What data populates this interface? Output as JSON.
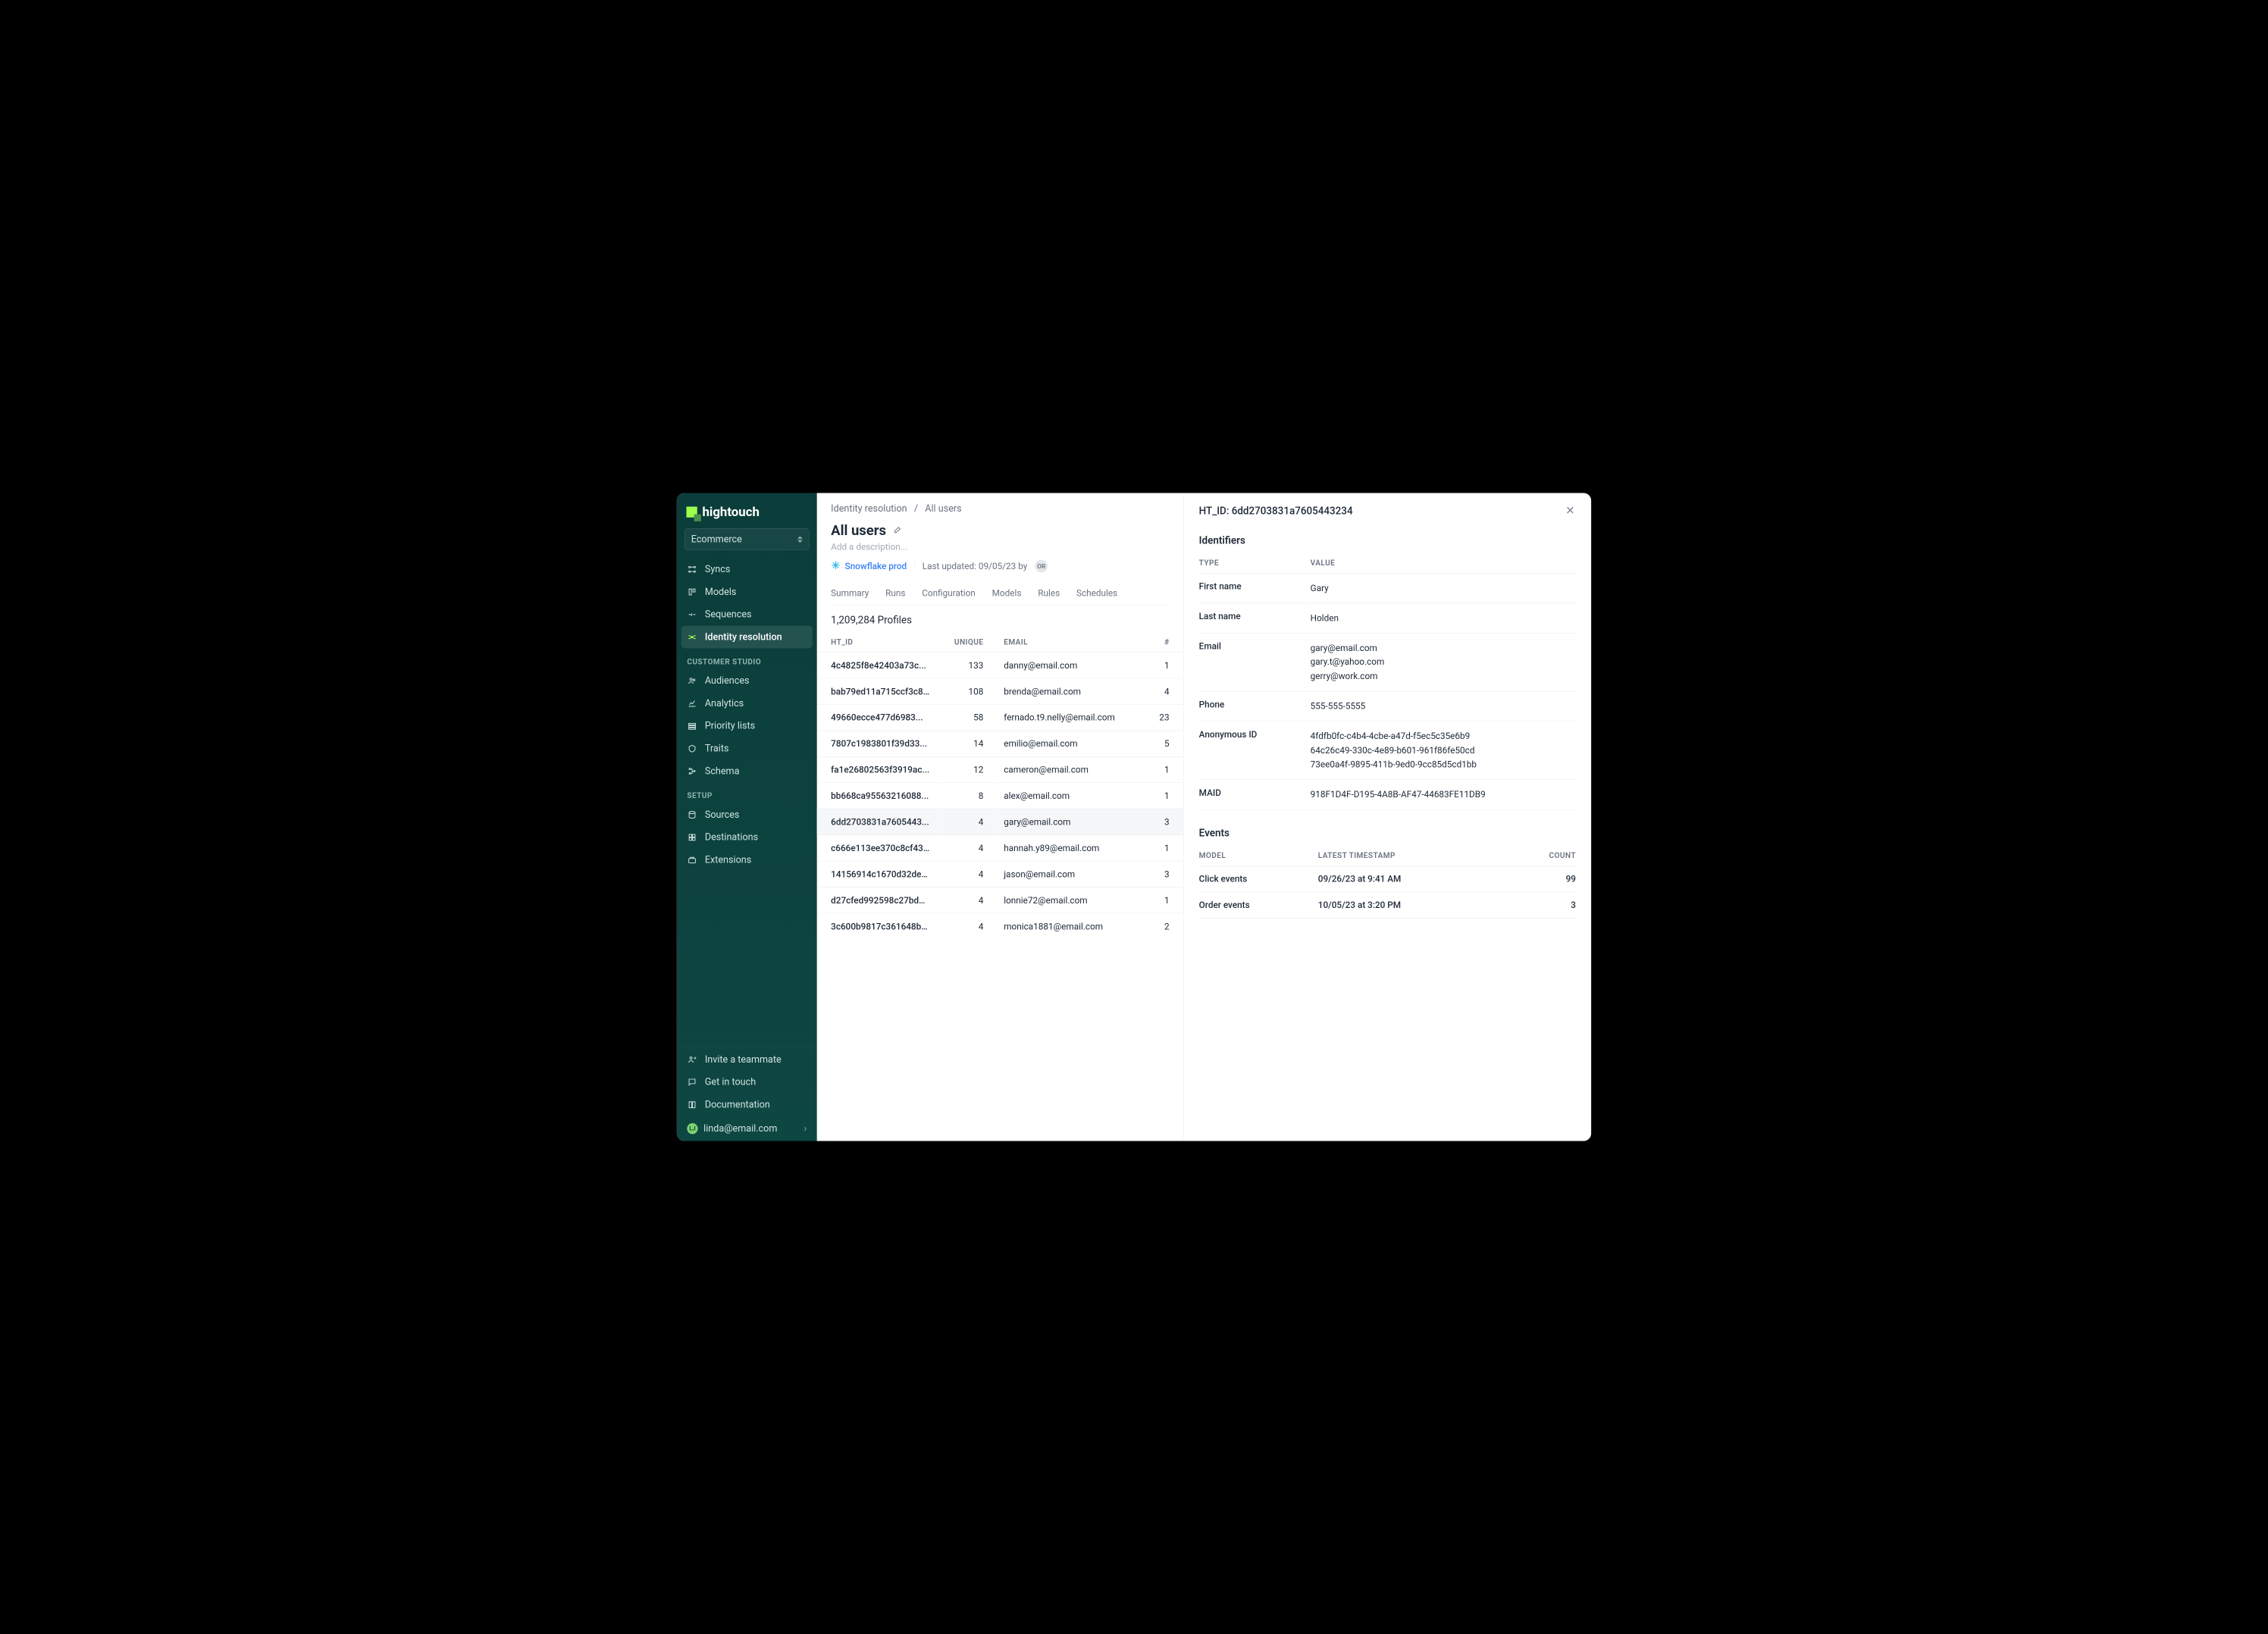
{
  "brand": "hightouch",
  "workspace": {
    "current": "Ecommerce"
  },
  "sidebar": {
    "items": [
      {
        "label": "Syncs"
      },
      {
        "label": "Models"
      },
      {
        "label": "Sequences"
      },
      {
        "label": "Identity resolution",
        "active": true
      }
    ],
    "studio_heading": "CUSTOMER STUDIO",
    "studio": [
      {
        "label": "Audiences"
      },
      {
        "label": "Analytics"
      },
      {
        "label": "Priority lists"
      },
      {
        "label": "Traits"
      },
      {
        "label": "Schema"
      }
    ],
    "setup_heading": "SETUP",
    "setup": [
      {
        "label": "Sources"
      },
      {
        "label": "Destinations"
      },
      {
        "label": "Extensions"
      }
    ],
    "footer": [
      {
        "label": "Invite a teammate"
      },
      {
        "label": "Get in touch"
      },
      {
        "label": "Documentation"
      }
    ],
    "user": {
      "initials": "LJ",
      "email": "linda@email.com"
    }
  },
  "crumbs": {
    "root": "Identity resolution",
    "sep": "/",
    "leaf": "All users"
  },
  "page": {
    "title": "All users",
    "desc": "Add a description...",
    "source": "Snowflake prod",
    "updated": "Last updated: 09/05/23 by",
    "updated_by": "OR"
  },
  "tabs": [
    "Summary",
    "Runs",
    "Configuration",
    "Models",
    "Rules",
    "Schedules"
  ],
  "profiles_count": "1,209,284 Profiles",
  "table": {
    "cols": [
      "HT_ID",
      "UNIQUE",
      "EMAIL",
      "#"
    ],
    "rows": [
      {
        "id": "4c4825f8e42403a73c...",
        "unique": "133",
        "email": "danny@email.com",
        "n": "1"
      },
      {
        "id": "bab79ed11a715ccf3c8...",
        "unique": "108",
        "email": "brenda@email.com",
        "n": "4"
      },
      {
        "id": "49660ecce477d6983...",
        "unique": "58",
        "email": "fernado.t9.nelly@email.com",
        "n": "23"
      },
      {
        "id": "7807c1983801f39d33...",
        "unique": "14",
        "email": "emilio@email.com",
        "n": "5"
      },
      {
        "id": "fa1e26802563f3919ac...",
        "unique": "12",
        "email": "cameron@email.com",
        "n": "1"
      },
      {
        "id": "bb668ca95563216088...",
        "unique": "8",
        "email": "alex@email.com",
        "n": "1"
      },
      {
        "id": "6dd2703831a7605443...",
        "unique": "4",
        "email": "gary@email.com",
        "n": "3",
        "sel": true
      },
      {
        "id": "c666e113ee370c8cf43...",
        "unique": "4",
        "email": "hannah.y89@email.com",
        "n": "1"
      },
      {
        "id": "14156914c1670d32dea...",
        "unique": "4",
        "email": "jason@email.com",
        "n": "3"
      },
      {
        "id": "d27cfed992598c27bd8...",
        "unique": "4",
        "email": "lonnie72@email.com",
        "n": "1"
      },
      {
        "id": "3c600b9817c361648b8...",
        "unique": "4",
        "email": "monica1881@email.com",
        "n": "2"
      }
    ]
  },
  "panel": {
    "title": "HT_ID: 6dd2703831a7605443234",
    "identifiers_heading": "Identifiers",
    "id_cols": [
      "TYPE",
      "VALUE"
    ],
    "identifiers": [
      {
        "type": "First name",
        "values": [
          "Gary"
        ]
      },
      {
        "type": "Last name",
        "values": [
          "Holden"
        ]
      },
      {
        "type": "Email",
        "values": [
          "gary@email.com",
          "gary.t@yahoo.com",
          "gerry@work.com"
        ]
      },
      {
        "type": "Phone",
        "values": [
          "555-555-5555"
        ]
      },
      {
        "type": "Anonymous ID",
        "values": [
          "4fdfb0fc-c4b4-4cbe-a47d-f5ec5c35e6b9",
          "64c26c49-330c-4e89-b601-961f86fe50cd",
          "73ee0a4f-9895-411b-9ed0-9cc85d5cd1bb"
        ]
      },
      {
        "type": "MAID",
        "values": [
          "918F1D4F-D195-4A8B-AF47-44683FE11DB9"
        ]
      }
    ],
    "events_heading": "Events",
    "ev_cols": [
      "MODEL",
      "LATEST TIMESTAMP",
      "COUNT"
    ],
    "events": [
      {
        "model": "Click events",
        "ts": "09/26/23 at 9:41 AM",
        "count": "99"
      },
      {
        "model": "Order events",
        "ts": "10/05/23 at 3:20 PM",
        "count": "3"
      }
    ]
  }
}
